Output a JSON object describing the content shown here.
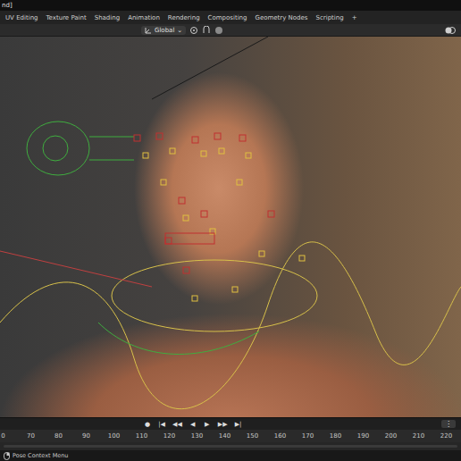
{
  "window": {
    "title": "nd]"
  },
  "workspace_tabs": [
    {
      "label": "UV Editing",
      "selected": false
    },
    {
      "label": "Texture Paint",
      "selected": false
    },
    {
      "label": "Shading",
      "selected": false
    },
    {
      "label": "Animation",
      "selected": false
    },
    {
      "label": "Rendering",
      "selected": false
    },
    {
      "label": "Compositing",
      "selected": false
    },
    {
      "label": "Geometry Nodes",
      "selected": false
    },
    {
      "label": "Scripting",
      "selected": false
    }
  ],
  "add_tab": "+",
  "header": {
    "orientation": "Global"
  },
  "timeline": {
    "controls": [
      "●",
      "|◀",
      "◀◀",
      "◀",
      "▶",
      "▶▶",
      "▶|"
    ],
    "menu": "⋮",
    "frames": [
      "0",
      "70",
      "80",
      "90",
      "100",
      "110",
      "120",
      "130",
      "140",
      "150",
      "160",
      "170",
      "180",
      "190",
      "200",
      "210",
      "220"
    ]
  },
  "status_bar": {
    "hint": "Pose Context Menu"
  }
}
